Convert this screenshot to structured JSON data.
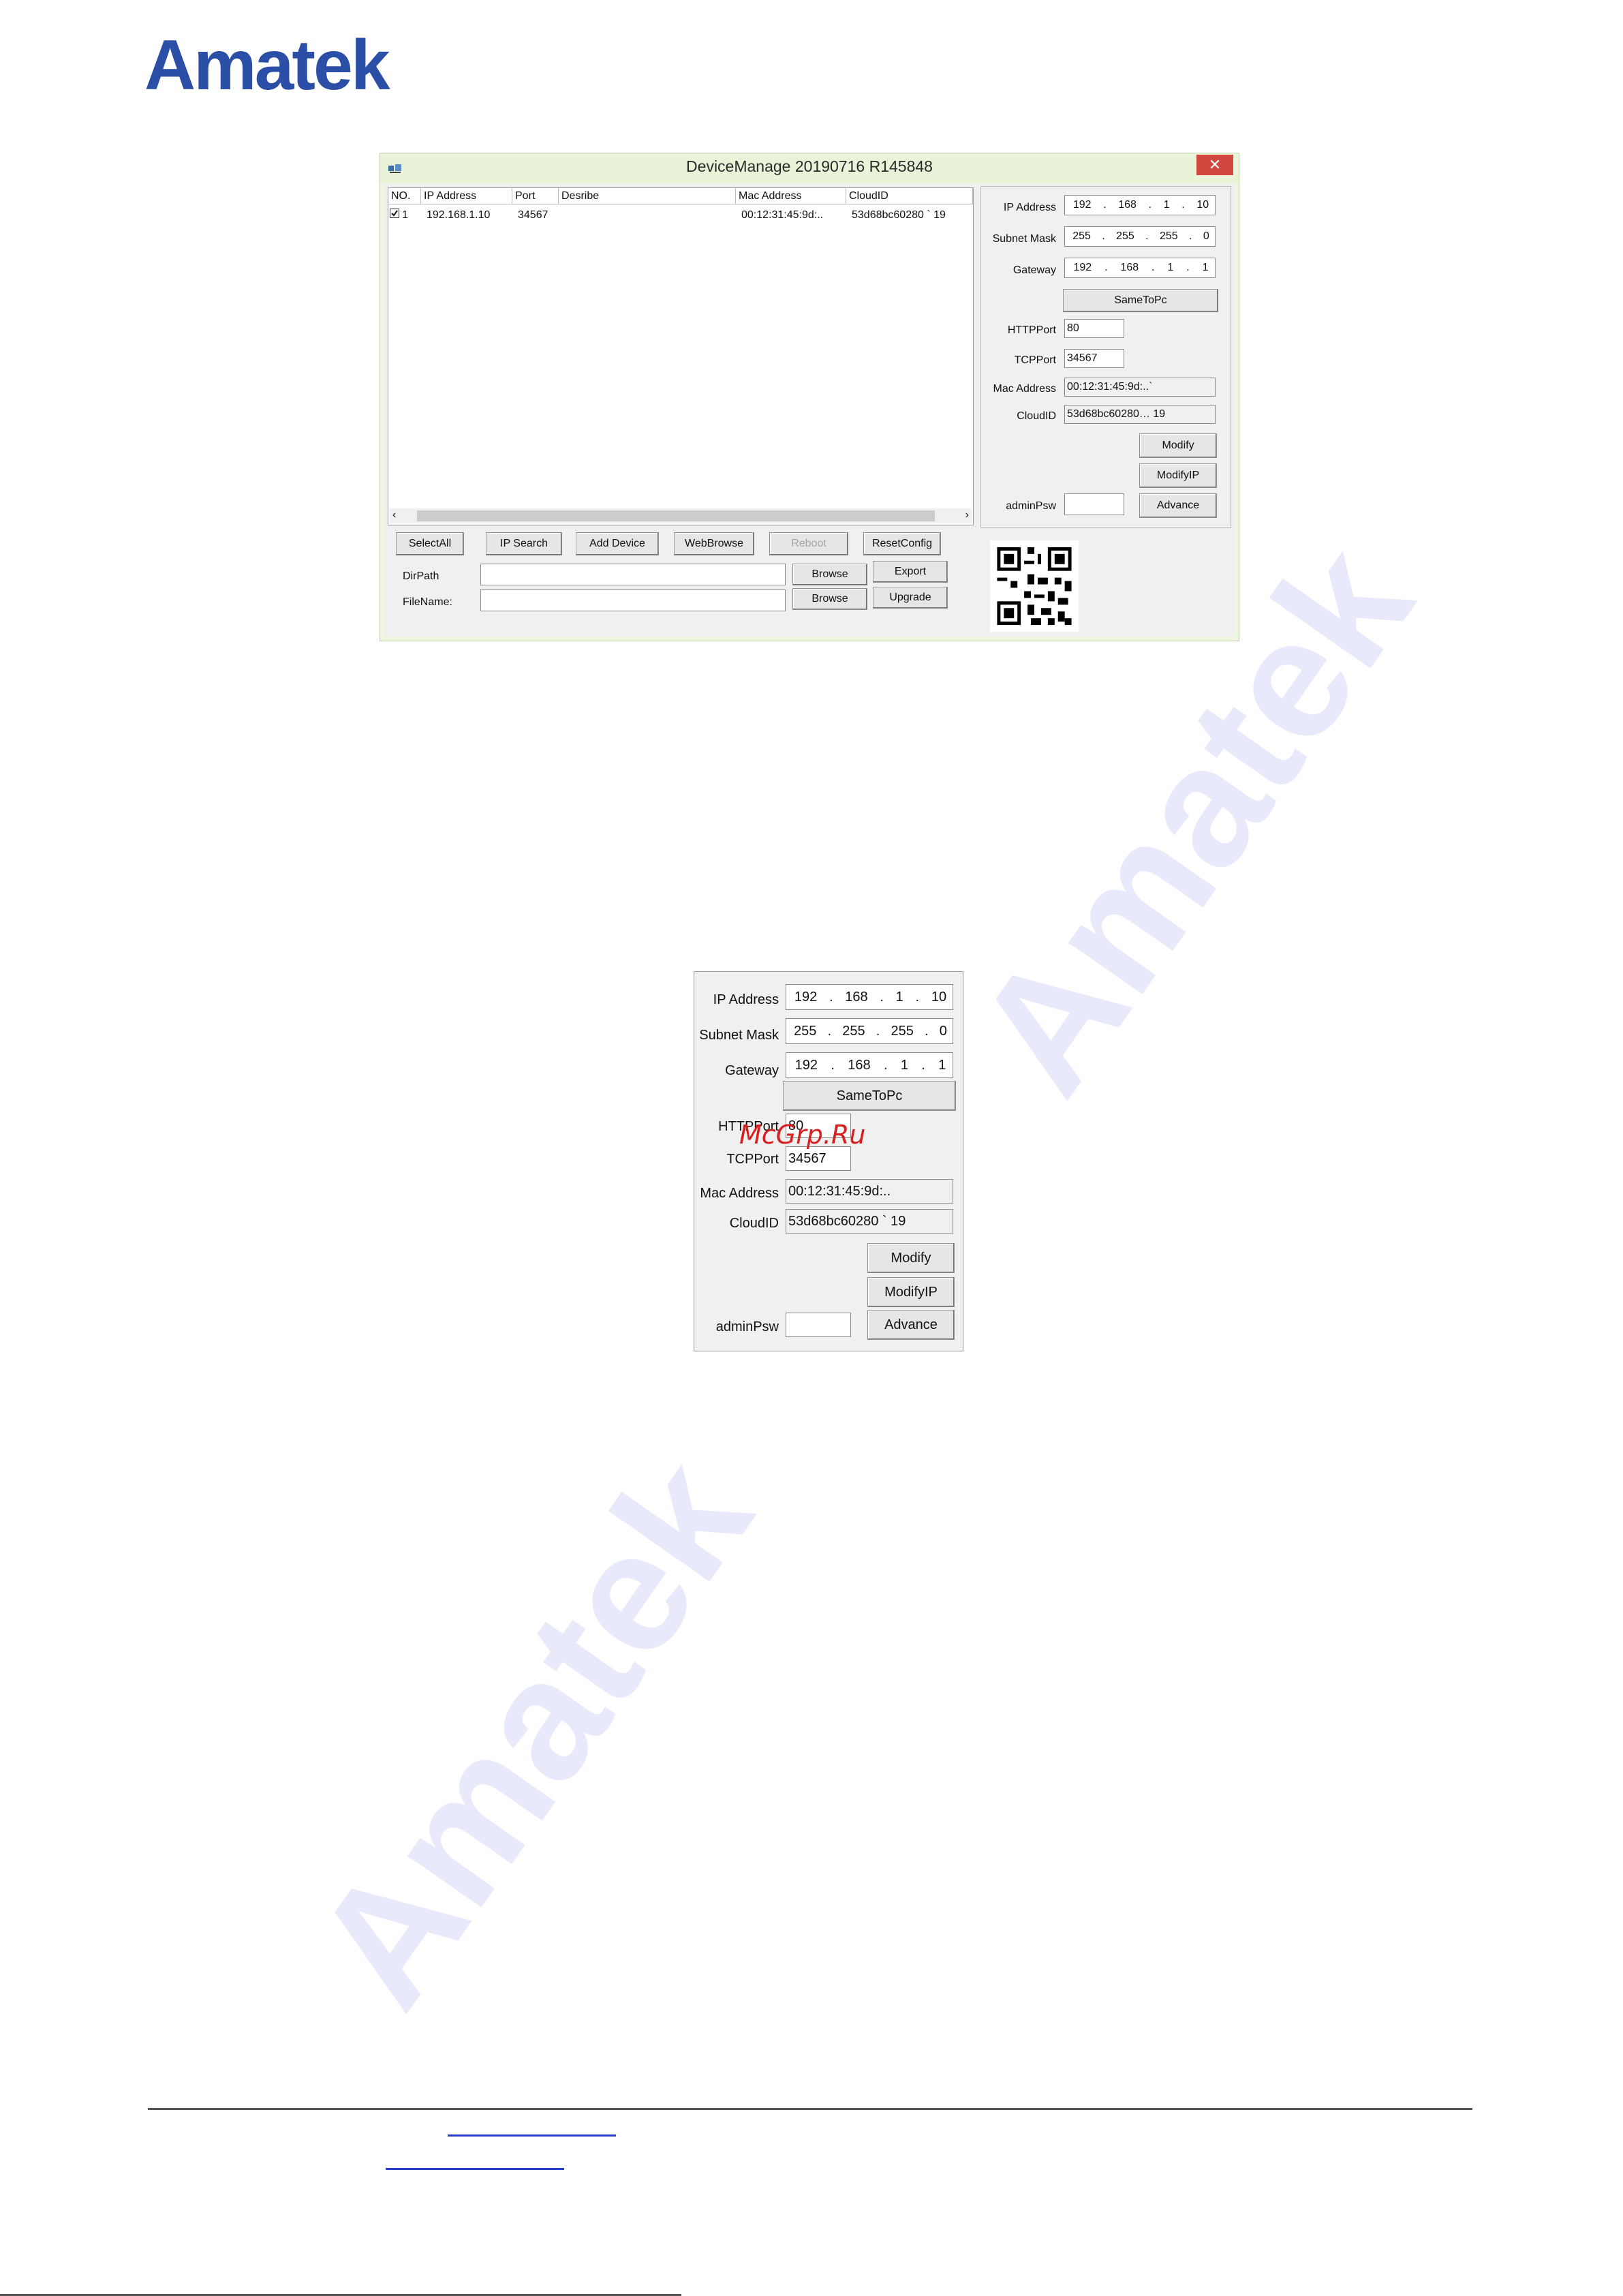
{
  "brand": {
    "logo_text": "Amatek",
    "logo_color": "#2b4fa6"
  },
  "watermark": {
    "text": "Amatek",
    "color": "#e8e9fa"
  },
  "window": {
    "title": "DeviceManage 20190716 R145848",
    "close_icon": "close-icon",
    "columns": [
      "NO.",
      "IP Address",
      "Port",
      "Desribe",
      "Mac Address",
      "CloudID"
    ],
    "rows": [
      {
        "checked": true,
        "no": "1",
        "ip": "192.168.1.10",
        "port": "34567",
        "describe": "",
        "mac": "00:12:31:45:9d:..",
        "cloud": "53d68bc60280 ` 19"
      }
    ],
    "buttons": {
      "select_all": "SelectAll",
      "ip_search": "IP Search",
      "add_device": "Add Device",
      "web_browse": "WebBrowse",
      "reboot": "Reboot",
      "reset_config": "ResetConfig",
      "browse1": "Browse",
      "export": "Export",
      "browse2": "Browse",
      "upgrade": "Upgrade"
    },
    "dir_path_label": "DirPath",
    "file_name_label": "FileName:",
    "dir_path_value": "",
    "file_name_value": "",
    "panel": {
      "ip_label": "IP Address",
      "ip": [
        "192",
        "168",
        "1",
        "10"
      ],
      "mask_label": "Subnet Mask",
      "mask": [
        "255",
        "255",
        "255",
        "0"
      ],
      "gateway_label": "Gateway",
      "gateway": [
        "192",
        "168",
        "1",
        "1"
      ],
      "same_to_pc": "SameToPc",
      "http_port_label": "HTTPPort",
      "http_port": "80",
      "tcp_port_label": "TCPPort",
      "tcp_port": "34567",
      "mac_label": "Mac Address",
      "mac": "00:12:31:45:9d:..`",
      "cloud_label": "CloudID",
      "cloud": "53d68bc60280… 19",
      "modify": "Modify",
      "modify_ip": "ModifyIP",
      "admin_psw_label": "adminPsw",
      "admin_psw": "",
      "advance": "Advance"
    }
  },
  "zoom_panel": {
    "ip_label": "IP Address",
    "ip": [
      "192",
      "168",
      "1",
      "10"
    ],
    "mask_label": "Subnet Mask",
    "mask": [
      "255",
      "255",
      "255",
      "0"
    ],
    "gateway_label": "Gateway",
    "gateway": [
      "192",
      "168",
      "1",
      "1"
    ],
    "same_to_pc": "SameToPc",
    "http_port_label": "HTTPPort",
    "http_port": "80",
    "tcp_port_label": "TCPPort",
    "tcp_port": "34567",
    "mac_label": "Mac Address",
    "mac": "00:12:31:45:9d:..",
    "cloud_label": "CloudID",
    "cloud": "53d68bc60280 ` 19",
    "modify": "Modify",
    "modify_ip": "ModifyIP",
    "admin_psw_label": "adminPsw",
    "admin_psw": "",
    "advance": "Advance"
  },
  "overlay_watermark": "McGrp.Ru"
}
